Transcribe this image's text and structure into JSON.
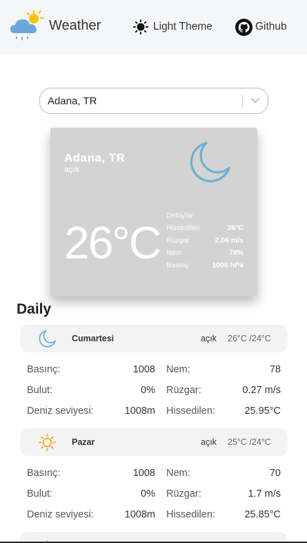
{
  "header": {
    "brand": "Weather",
    "theme_label": "Light Theme",
    "github_label": "Github"
  },
  "search": {
    "selected_city": "Adana, TR"
  },
  "current": {
    "city": "Adana, TR",
    "condition": "açık",
    "temperature": "26°C",
    "details_title": "Detaylar",
    "details": [
      {
        "label": "Hissedilen",
        "value": "26°C"
      },
      {
        "label": "Rüzgar",
        "value": "2.06 m/s"
      },
      {
        "label": "Nem",
        "value": "78%"
      },
      {
        "label": "Basınç",
        "value": "1008 hPa"
      }
    ]
  },
  "daily": {
    "title": "Daily",
    "days": [
      {
        "name": "Cumartesi",
        "icon": "moon-icon",
        "condition": "açık",
        "range": "26°C /24°C",
        "rows": [
          {
            "l1": "Basınç:",
            "v1": "1008",
            "l2": "Nem:",
            "v2": "78"
          },
          {
            "l1": "Bulut:",
            "v1": "0%",
            "l2": "Rüzgar:",
            "v2": "0.27 m/s"
          },
          {
            "l1": "Deniz seviyesi:",
            "v1": "1008m",
            "l2": "Hissedilen:",
            "v2": "25.95°C"
          }
        ]
      },
      {
        "name": "Pazar",
        "icon": "sun-icon",
        "condition": "açık",
        "range": "25°C /24°C",
        "rows": [
          {
            "l1": "Basınç:",
            "v1": "1008",
            "l2": "Nem:",
            "v2": "70"
          },
          {
            "l1": "Bulut:",
            "v1": "0%",
            "l2": "Rüzgar:",
            "v2": "1.7 m/s"
          },
          {
            "l1": "Deniz seviyesi:",
            "v1": "1008m",
            "l2": "Hissedilen:",
            "v2": "25.85°C"
          }
        ]
      }
    ]
  },
  "colors": {
    "moon_blue": "#6ab0d4",
    "sun_orange": "#f5a623",
    "card_bg": "#d3d3d3"
  }
}
